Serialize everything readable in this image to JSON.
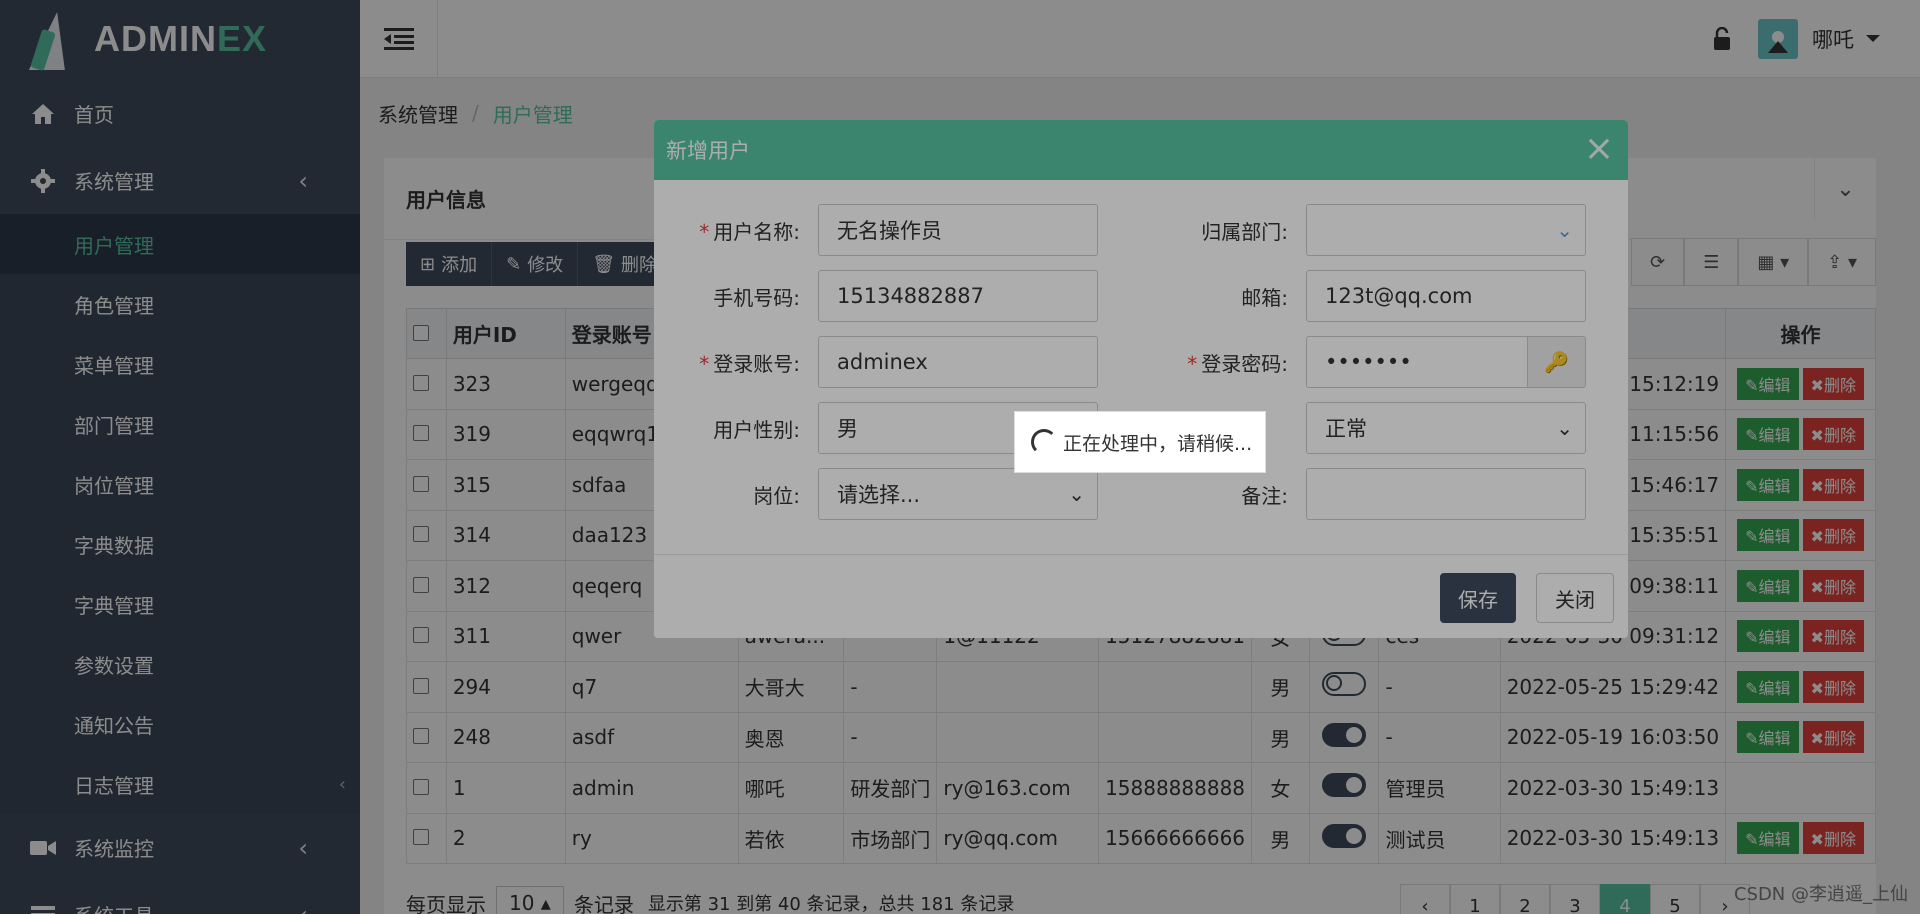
{
  "app": {
    "logo_main": "ADMIN",
    "logo_accent": "EX"
  },
  "sidebar": {
    "home": "首页",
    "system": "系统管理",
    "sub_items": [
      "用户管理",
      "角色管理",
      "菜单管理",
      "部门管理",
      "岗位管理",
      "字典数据",
      "字典管理",
      "参数设置",
      "通知公告",
      "日志管理"
    ],
    "monitor": "系统监控",
    "tools": "系统工具"
  },
  "topbar": {
    "user_name": "哪吒"
  },
  "breadcrumb": {
    "root": "系统管理",
    "current": "用户管理"
  },
  "panel": {
    "title": "用户信息"
  },
  "toolbar": {
    "add": "添加",
    "edit": "修改",
    "delete": "删除"
  },
  "table": {
    "headers": {
      "id": "用户ID",
      "login": "登录账号",
      "action": "操作"
    },
    "rows": [
      {
        "id": "323",
        "login": "wergeqq",
        "name": "",
        "dept": "",
        "email": "",
        "phone": "",
        "sex": "",
        "status": "",
        "role": "",
        "time": "15:12:19",
        "actions": true
      },
      {
        "id": "319",
        "login": "eqqwrq1",
        "name": "",
        "dept": "",
        "email": "",
        "phone": "",
        "sex": "",
        "status": "",
        "role": "",
        "time": "11:15:56",
        "actions": true
      },
      {
        "id": "315",
        "login": "sdfaa",
        "name": "",
        "dept": "",
        "email": "",
        "phone": "",
        "sex": "",
        "status": "",
        "role": "",
        "time": "15:46:17",
        "actions": true
      },
      {
        "id": "314",
        "login": "daa123",
        "name": "",
        "dept": "",
        "email": "",
        "phone": "",
        "sex": "",
        "status": "",
        "role": "",
        "time": "15:35:51",
        "actions": true
      },
      {
        "id": "312",
        "login": "qeqerq",
        "name": "",
        "dept": "",
        "email": "",
        "phone": "",
        "sex": "",
        "status": "",
        "role": "",
        "time": "09:38:11",
        "actions": true
      },
      {
        "id": "311",
        "login": "qwer",
        "name": "awera...",
        "dept": "-",
        "email": "1@11122",
        "phone": "15127882881",
        "sex": "女",
        "status": "off",
        "role": "ces",
        "time": "2022-05-30 09:31:12",
        "actions": true
      },
      {
        "id": "294",
        "login": "q7",
        "name": "大哥大",
        "dept": "-",
        "email": "",
        "phone": "",
        "sex": "男",
        "status": "off",
        "role": "-",
        "time": "2022-05-25 15:29:42",
        "actions": true
      },
      {
        "id": "248",
        "login": "asdf",
        "name": "奥恩",
        "dept": "-",
        "email": "",
        "phone": "",
        "sex": "男",
        "status": "on",
        "role": "-",
        "time": "2022-05-19 16:03:50",
        "actions": true
      },
      {
        "id": "1",
        "login": "admin",
        "name": "哪吒",
        "dept": "研发部门",
        "email": "ry@163.com",
        "phone": "15888888888",
        "sex": "女",
        "status": "on",
        "role": "管理员",
        "time": "2022-03-30 15:49:13",
        "actions": false
      },
      {
        "id": "2",
        "login": "ry",
        "name": "若依",
        "dept": "市场部门",
        "email": "ry@qq.com",
        "phone": "15666666666",
        "sex": "男",
        "status": "on",
        "role": "测试员",
        "time": "2022-03-30 15:49:13",
        "actions": true
      }
    ],
    "edit_label": "编辑",
    "delete_label": "删除"
  },
  "footer": {
    "per_page_prefix": "每页显示",
    "per_page_value": "10",
    "per_page_suffix": "条记录",
    "summary": "显示第 31 到第 40 条记录，总共 181 条记录",
    "pages": [
      "‹",
      "1",
      "2",
      "3",
      "4",
      "5",
      "›"
    ]
  },
  "modal": {
    "title": "新增用户",
    "close": "×",
    "fields": {
      "username_label": "用户名称:",
      "username_value": "无名操作员",
      "dept_label": "归属部门:",
      "dept_value": "",
      "phone_label": "手机号码:",
      "phone_value": "15134882887",
      "email_label": "邮箱:",
      "email_value": "123t@qq.com",
      "login_label": "登录账号:",
      "login_value": "adminex",
      "password_label": "登录密码:",
      "password_value": "•••••••",
      "sex_label": "用户性别:",
      "sex_value": "男",
      "status_value": "正常",
      "post_label": "岗位:",
      "post_value": "请选择...",
      "remark_label": "备注:",
      "remark_value": ""
    },
    "save": "保存",
    "cancel": "关闭"
  },
  "loading": {
    "text": "正在处理中，请稍候..."
  },
  "watermark": "CSDN @李逍遥_上仙"
}
